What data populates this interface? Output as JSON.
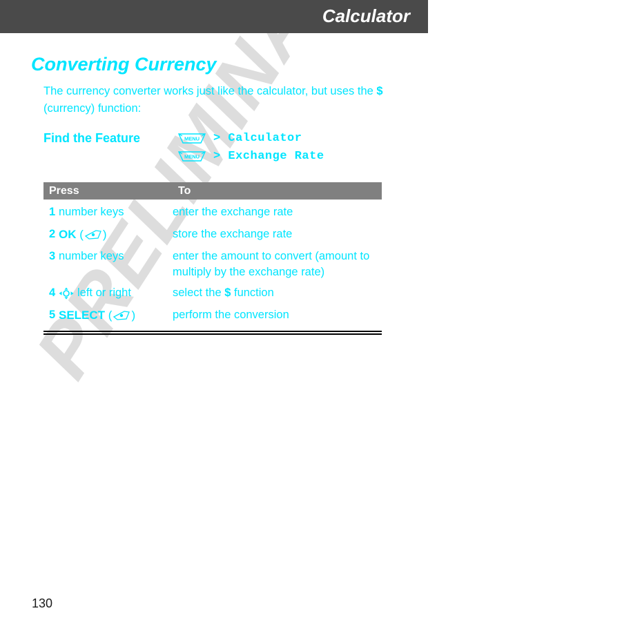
{
  "header": {
    "chapter_title": "Calculator",
    "band_color": "#4a4a4a"
  },
  "watermark": {
    "text": "PRELIMINARY",
    "color": "#dddddd"
  },
  "section": {
    "heading": "Converting Currency",
    "accent_color": "#00e5ff"
  },
  "intro": {
    "line1": "The currency converter works just like the calculator, but uses the ",
    "symbol": "$",
    "line2": " (currency) function:"
  },
  "find_the_feature": {
    "label": "Find the Feature",
    "rows": [
      {
        "key_icon": "menu-key-icon",
        "key_label": "MENU",
        "path": "> Calculator"
      },
      {
        "key_icon": "menu-key-icon",
        "key_label": "MENU",
        "path": "> Exchange Rate"
      }
    ]
  },
  "table": {
    "columns": [
      "Press",
      "To"
    ],
    "rows": [
      {
        "num": "1",
        "press_text": "number keys",
        "press_bold": "",
        "press_icon": "",
        "press_suffix": "",
        "to": "enter the exchange rate",
        "to_bold": "",
        "to_suffix": ""
      },
      {
        "num": "2",
        "press_text": "",
        "press_bold": "OK",
        "press_icon": "soft-key-icon",
        "press_suffix": "",
        "to": "store the exchange rate",
        "to_bold": "",
        "to_suffix": ""
      },
      {
        "num": "3",
        "press_text": "number keys",
        "press_bold": "",
        "press_icon": "",
        "press_suffix": "",
        "to": "enter the amount to convert (amount to multiply by the exchange rate)",
        "to_bold": "",
        "to_suffix": ""
      },
      {
        "num": "4",
        "press_text": "left or right",
        "press_bold": "",
        "press_icon": "nav-key-icon",
        "press_suffix": "",
        "to": "select the ",
        "to_bold": "$",
        "to_suffix": " function"
      },
      {
        "num": "5",
        "press_text": "",
        "press_bold": "SELECT",
        "press_icon": "soft-key-icon",
        "press_suffix": "",
        "to": "perform the conversion",
        "to_bold": "",
        "to_suffix": ""
      }
    ]
  },
  "footer": {
    "page_number": "130"
  }
}
